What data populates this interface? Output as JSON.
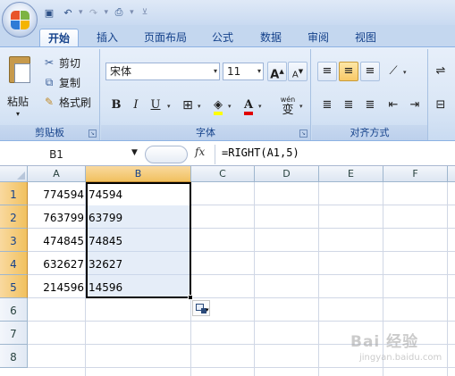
{
  "ribbon_tabs": [
    "开始",
    "插入",
    "页面布局",
    "公式",
    "数据",
    "审阅",
    "视图"
  ],
  "clipboard": {
    "paste_label": "粘贴",
    "cut_label": "剪切",
    "copy_label": "复制",
    "format_painter_label": "格式刷",
    "group_label": "剪贴板"
  },
  "font": {
    "name": "宋体",
    "size": "11",
    "bold": "B",
    "italic": "I",
    "underline": "U",
    "grow": "A",
    "shrink": "A",
    "font_color": "A",
    "phonetic": "wén",
    "phonetic_char": "变",
    "group_label": "字体"
  },
  "alignment": {
    "group_label": "对齐方式",
    "active_vertical": "middle"
  },
  "formula_bar": {
    "name_box": "B1",
    "fx": "fx",
    "formula": "=RIGHT(A1,5)"
  },
  "columns": [
    "A",
    "B",
    "C",
    "D",
    "E",
    "F"
  ],
  "selected_column": "B",
  "rows": [
    "1",
    "2",
    "3",
    "4",
    "5",
    "6",
    "7",
    "8"
  ],
  "selected_rows": [
    "1",
    "2",
    "3",
    "4",
    "5"
  ],
  "cells": [
    {
      "row": 1,
      "a": "774594",
      "b": "74594"
    },
    {
      "row": 2,
      "a": "763799",
      "b": "63799"
    },
    {
      "row": 3,
      "a": "474845",
      "b": "74845"
    },
    {
      "row": 4,
      "a": "632627",
      "b": "32627"
    },
    {
      "row": 5,
      "a": "214596",
      "b": "14596"
    }
  ],
  "watermark": {
    "text": "Bai 经验",
    "sub": "jingyan.baidu.com"
  },
  "colors": {
    "accent": "#15428b",
    "selected_header": "#f1c15f",
    "selection_fill": "#c6d6f0"
  }
}
